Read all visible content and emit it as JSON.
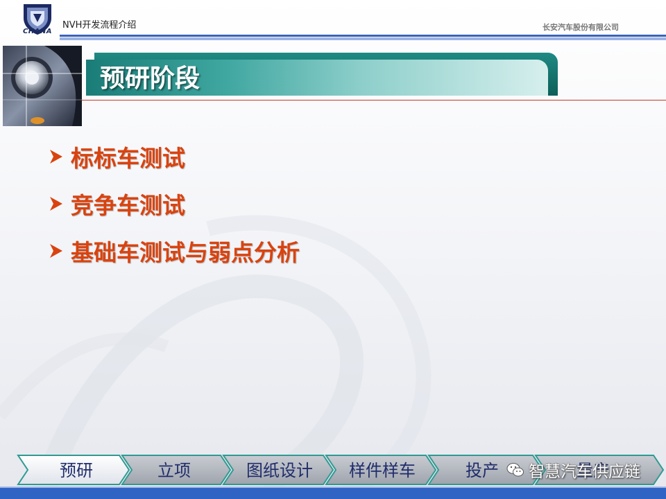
{
  "header": {
    "logo_text": "CHANA",
    "doc_title": "NVH开发流程介绍",
    "company": "长安汽车股份有限公司"
  },
  "section": {
    "title": "预研阶段"
  },
  "bullets": [
    "标标车测试",
    "竞争车测试",
    "基础车测试与弱点分析"
  ],
  "nav": {
    "items": [
      "预研",
      "立项",
      "图纸设计",
      "样件样车",
      "投产",
      "量产"
    ],
    "active_index": 0
  },
  "overlay": {
    "wechat_label": "智慧汽车供应链"
  },
  "colors": {
    "bullet_text": "#d9430f",
    "banner_teal": "#1a7c76",
    "header_blue": "#3a62b8",
    "nav_text": "#1f2d6b"
  }
}
